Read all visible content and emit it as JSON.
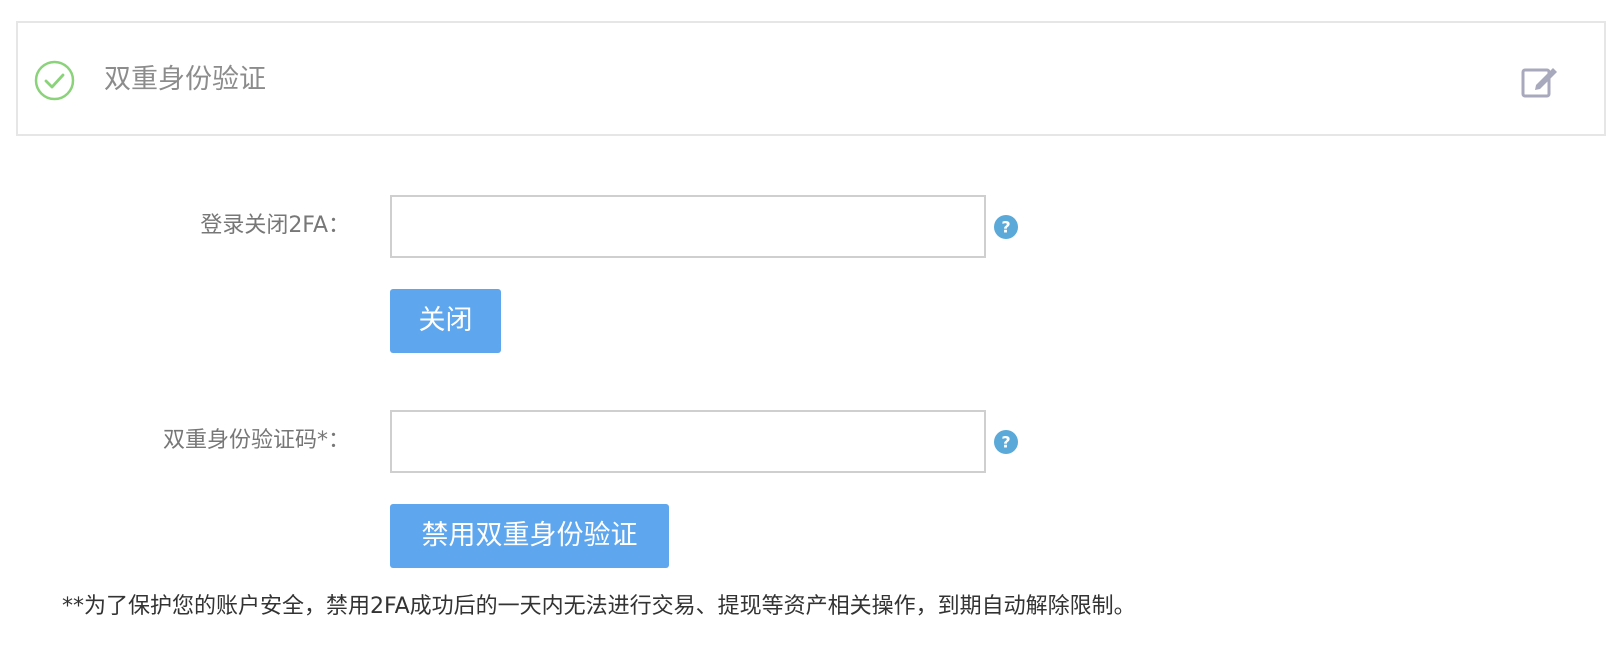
{
  "header": {
    "title": "双重身份验证",
    "status_icon": "check-circle-icon",
    "edit_icon": "edit-icon",
    "status_color": "#8bd37a",
    "edit_color": "#a9a9bd"
  },
  "form": {
    "login_close": {
      "label": "登录关闭2FA：",
      "value": "",
      "placeholder": "",
      "help_icon": "help-circle-icon"
    },
    "close_button": "关闭",
    "code": {
      "label": "双重身份验证码*：",
      "value": "",
      "placeholder": "",
      "help_icon": "help-circle-icon"
    },
    "disable_button": "禁用双重身份验证"
  },
  "note": "**为了保护您的账户安全，禁用2FA成功后的一天内无法进行交易、提现等资产相关操作，到期自动解除限制。",
  "colors": {
    "accent": "#5ea6ee",
    "help": "#5aa9d8"
  }
}
